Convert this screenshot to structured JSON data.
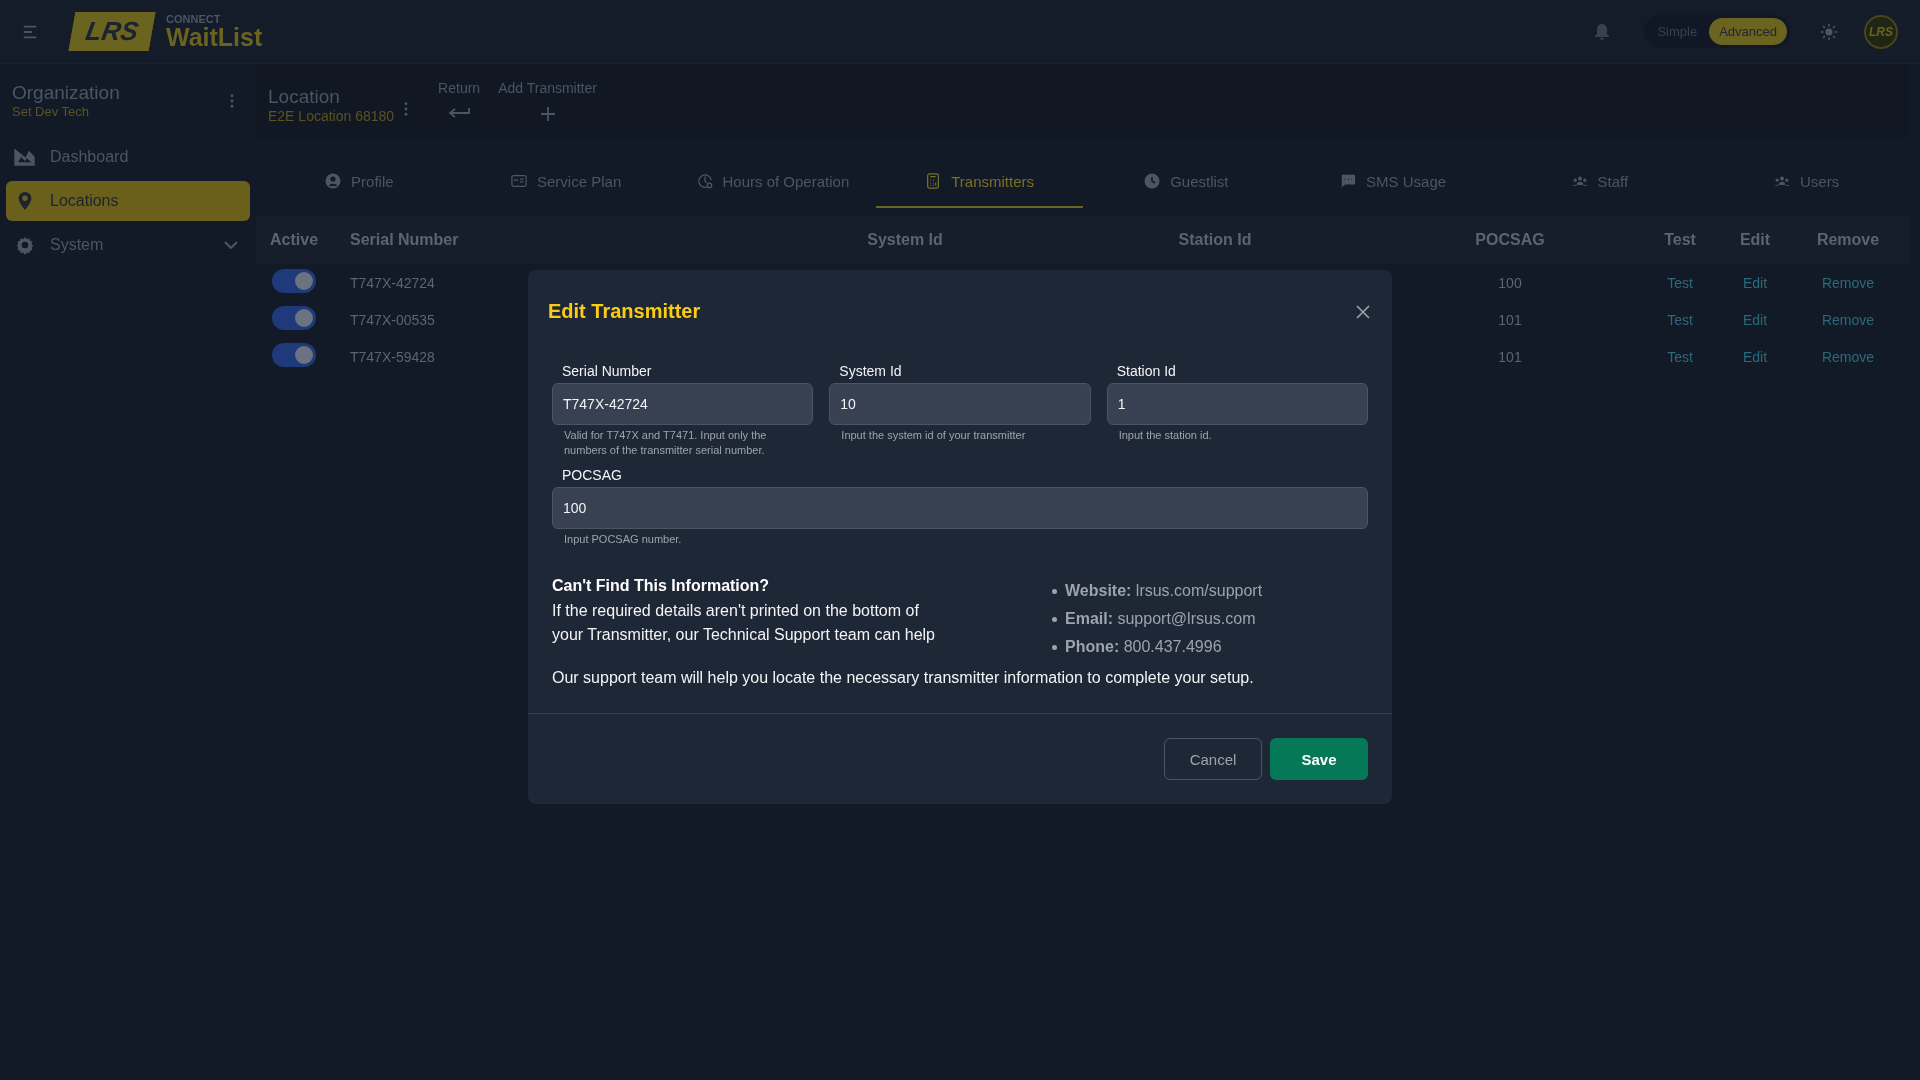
{
  "header": {
    "logo": "LRS",
    "brand_top": "CONNECT",
    "brand": "WaitList",
    "modes": [
      {
        "label": "Simple",
        "selected": false
      },
      {
        "label": "Advanced",
        "selected": true
      }
    ],
    "avatar": "LRS"
  },
  "sidebar": {
    "title": "Organization",
    "subtitle": "Set Dev Tech",
    "items": [
      {
        "label": "Dashboard",
        "selected": false
      },
      {
        "label": "Locations",
        "selected": true
      },
      {
        "label": "System",
        "selected": false
      }
    ]
  },
  "location": {
    "title": "Location",
    "subtitle": "E2E Location 68180",
    "actions": [
      {
        "label": "Return"
      },
      {
        "label": "Add Transmitter"
      }
    ]
  },
  "tabs": [
    {
      "label": "Profile",
      "selected": false
    },
    {
      "label": "Service Plan",
      "selected": false
    },
    {
      "label": "Hours of Operation",
      "selected": false
    },
    {
      "label": "Transmitters",
      "selected": true
    },
    {
      "label": "Guestlist",
      "selected": false
    },
    {
      "label": "SMS Usage",
      "selected": false
    },
    {
      "label": "Staff",
      "selected": false
    },
    {
      "label": "Users",
      "selected": false
    }
  ],
  "table": {
    "columns": [
      "Active",
      "Serial Number",
      "System Id",
      "Station Id",
      "POCSAG",
      "Test",
      "Edit",
      "Remove"
    ],
    "rows": [
      {
        "active": true,
        "serial": "T747X-42724",
        "pocsag": "100",
        "test": "Test",
        "edit": "Edit",
        "remove": "Remove"
      },
      {
        "active": true,
        "serial": "T747X-00535",
        "pocsag": "101",
        "test": "Test",
        "edit": "Edit",
        "remove": "Remove"
      },
      {
        "active": true,
        "serial": "T747X-59428",
        "pocsag": "101",
        "test": "Test",
        "edit": "Edit",
        "remove": "Remove"
      }
    ]
  },
  "dialog": {
    "title": "Edit Transmitter",
    "fields": [
      {
        "label": "Serial Number",
        "value": "T747X-42724",
        "help": "Valid for T747X and T7471. Input only the numbers of the transmitter serial number."
      },
      {
        "label": "System Id",
        "value": "10",
        "help": "Input the system id of your transmitter"
      },
      {
        "label": "Station Id",
        "value": "1",
        "help": "Input the station id."
      },
      {
        "label": "POCSAG",
        "value": "100",
        "help": "Input POCSAG number."
      }
    ],
    "info": {
      "heading": "Can't Find This Information?",
      "text": "If the required details aren't printed on the bottom of your Transmitter, our Technical Support team can help",
      "contacts": [
        {
          "label": "Website:",
          "value": "lrsus.com/support"
        },
        {
          "label": "Email:",
          "value": "support@lrsus.com"
        },
        {
          "label": "Phone:",
          "value": "800.437.4996"
        }
      ],
      "note": "Our support team will help you locate the necessary transmitter information to complete your setup."
    },
    "buttons": [
      {
        "label": "Cancel",
        "kind": "secondary"
      },
      {
        "label": "Save",
        "kind": "primary"
      }
    ]
  }
}
